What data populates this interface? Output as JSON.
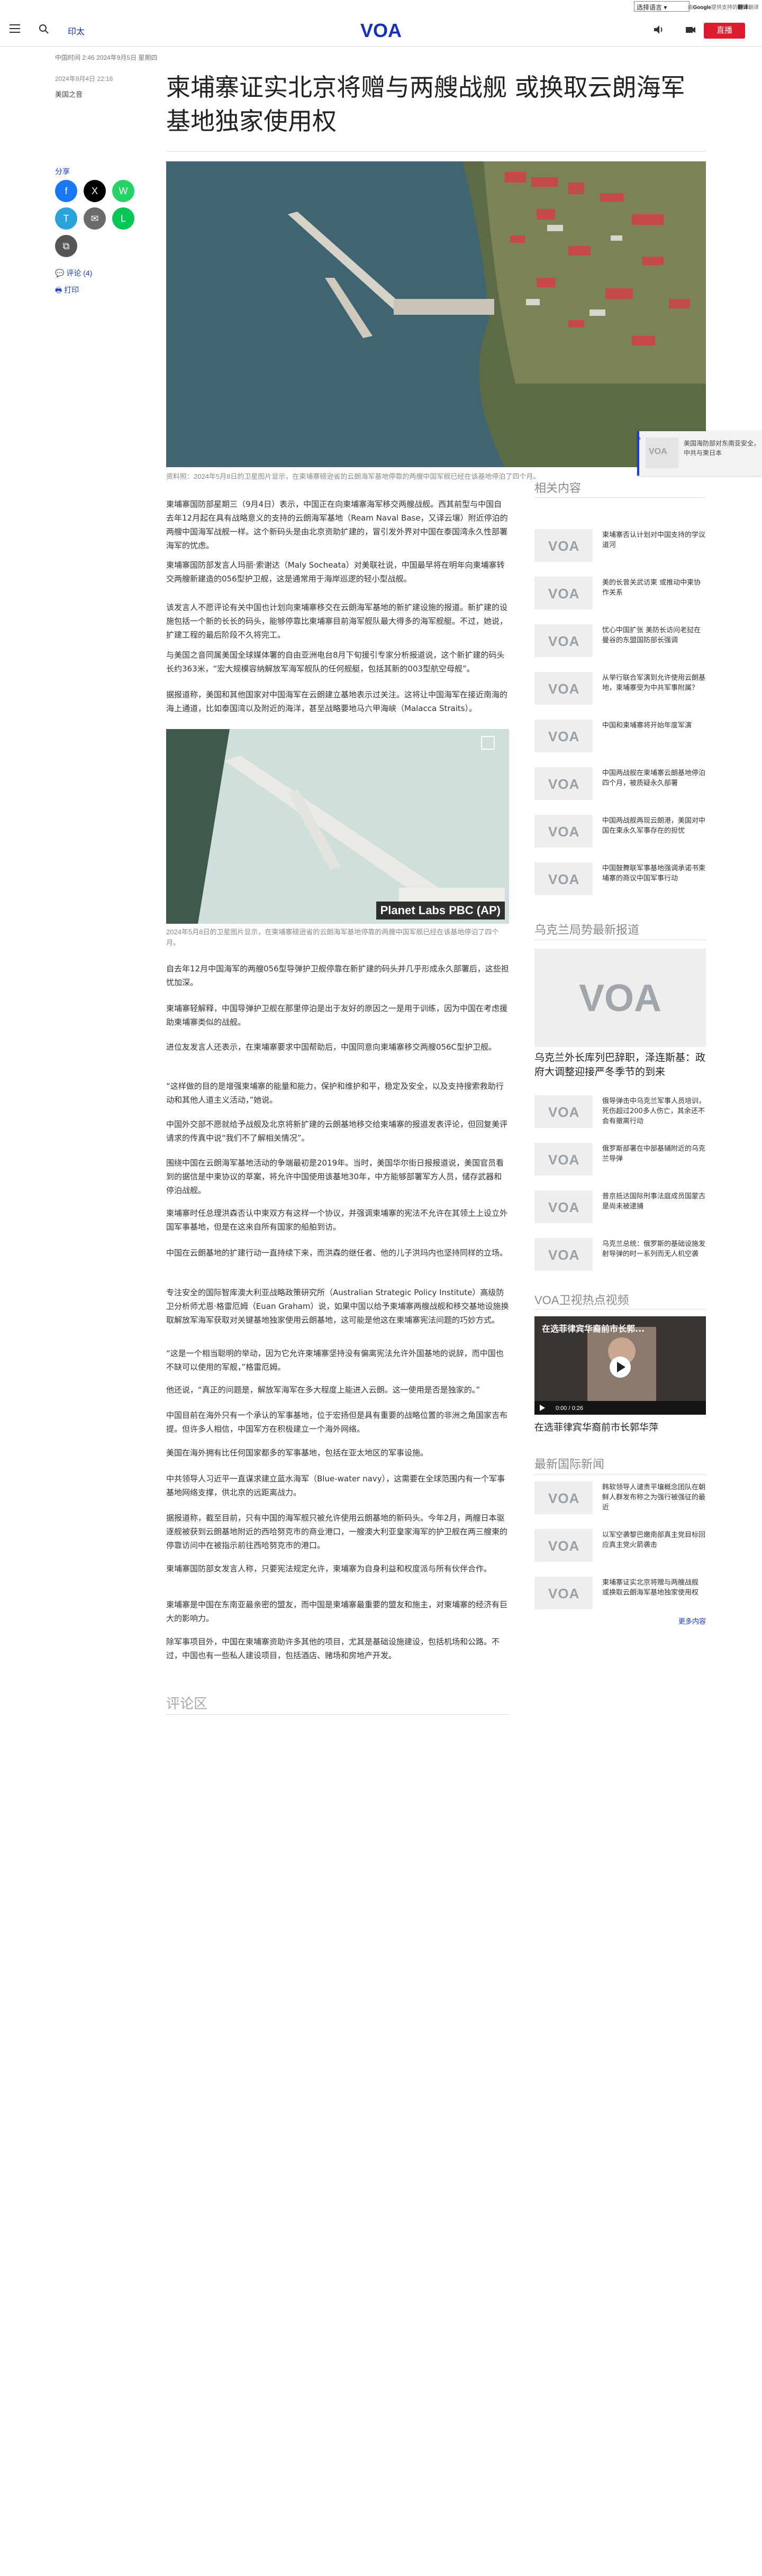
{
  "lang": {
    "select_label": "选择语言",
    "powered_prefix": "由",
    "powered_brand": "Google",
    "powered_mid": "提供支持的",
    "powered_service": "翻译",
    "powered_suffix": "翻译"
  },
  "header": {
    "edition": "印太",
    "logo": "VOA",
    "live": "直播"
  },
  "article": {
    "update_line": "中国时间 2:46 2024年9月5日 星期四",
    "published": "2024年9月4日 22:16",
    "author": "美国之音",
    "title": "柬埔寨证实北京将赠与两艘战舰 或换取云朗海军基地独家使用权",
    "caption": "资料照：2024年5月8日的卫星图片显示，在柬埔寨磅逊省的云朗海军基地停靠的两艘中国军舰已经在该基地停泊了四个月。",
    "inline_caption": "2024年5月8日的卫星图片显示，在柬埔寨磅逊省的云朗海军基地停靠的两艘中国军舰已经在该基地停泊了四个月。",
    "inline_credit": "Planet Labs PBC (AP)",
    "comments_heading": "评论区",
    "paragraphs": [
      "柬埔寨国防部星期三（9月4日）表示，中国正在向柬埔寨海军移交两艘战舰。西其前型与中国自去年12月起在具有战略意义的支持的云朗海军基地（Ream Naval Base，又译云壤）附近停泊的两艘中国海军战舰一样。这个新码头是由北京资助扩建的，冒引发外界对中国在泰国湾永久性部署海军的忧虑。",
      "柬埔寨国防部发言人玛丽·索谢达（Maly Socheata）对美联社说，中国最早将在明年向柬埔寨转交两艘新建造的056型护卫舰，这是通常用于海岸巡逻的轻小型战舰。",
      "该发言人不愿评论有关中国也计划向柬埔寨移交在云朗海军基地的新扩建设施的报道。新扩建的设施包括一个新的长长的码头，能够停靠比柬埔寨目前海军舰队最大得多的海军舰艇。不过，她说，扩建工程的最后阶段不久将完工。",
      "与美国之音同属美国全球媒体署的自由亚洲电台8月下旬援引专家分析报道说，这个新扩建的码头长约363米，“宏大规模容纳解放军海军舰队的任何舰艇，包括其新的003型航空母舰”。",
      "据报道称，美国和其他国家对中国海军在云朗建立基地表示过关注。这将让中国海军在接近南海的海上通道，比如泰国湾以及附近的海洋，甚至战略要地马六甲海峡（Malacca Straits）。",
      "自去年12月中国海军的两艘056型导弹护卫舰停靠在新扩建的码头并几乎形成永久部署后，这些担忧加深。",
      "柬埔寨轻解释，中国导弹护卫舰在那里停泊是出于友好的原因之一是用于训练，因为中国在考虑援助柬埔寨类似的战舰。",
      "进位友发言人还表示，在柬埔寨要求中国帮助后，中国同意向柬埔寨移交两艘056C型护卫舰。",
      "“这样做的目的是增强柬埔寨的能量和能力，保护和维护和平，稳定及安全，以及支持搜索救助行动和其他人道主义活动，”她说。",
      "中国外交部不愿就给予战舰及北京将新扩建的云朗基地移交给柬埔寨的报道发表评论，但回复美评请求的传真中说“我们不了解相关情况”。",
      "围绕中国在云朗海军基地活动的争端最初是2019年。当时，美国华尔街日报报道说，美国官员看到的据信是中柬协议的草案，将允许中国使用该基地30年，中方能够部署军方人员，储存武器和停泊战舰。",
      "柬埔寨时任总理洪森否认中柬双方有这样一个协议，并强调柬埔寨的宪法不允许在其领土上设立外国军事基地，但是在这来自所有国家的船舶到访。",
      "中国在云朗基地的扩建行动一直持续下来，而洪森的继任者、他的儿子洪玛内也坚持同样的立场。",
      "专注安全的国际智库澳大利亚战略政策研究所（Australian Strategic Policy Institute）高级防卫分析师尤恩·格雷厄姆（Euan Graham）说，如果中国以给予柬埔寨两艘战舰和移交基地设施换取解放军海军获取对关键基地独家使用云朗基地，这可能是他这在柬埔寨宪法问题的巧妙方式。",
      "“这是一个相当聪明的举动，因为它允许柬埔寨坚持没有偏离宪法允许外国基地的说辞，而中国也不缺可以使用的军舰，”格雷厄姆。",
      "他还说，“真正的问题是，解放军海军在多大程度上能进入云朗。这一使用是否是独家的。”",
      "中国目前在海外只有一个承认的军事基地，位于宏扬但是具有重要的战略位置的非洲之角国家吉布提。但许多人相信，中国军方在积极建立一个海外网络。",
      "美国在海外拥有比任何国家都多的军事基地，包括在亚太地区的军事设施。",
      "中共领导人习近平一直谋求建立蓝水海军（Blue-water navy），这需要在全球范围内有一个军事基地网络支撑，供北京的远距离战力。",
      "据报道称，截至目前，只有中国的海军舰只被允许使用云朗基地的新码头。今年2月，两艘日本驱逐舰被获到云朗基地附近的西哈努克市的商业港口，一艘澳大利亚皇家海军的护卫舰在两三艘柬的停靠访问中在被指示前往西哈努克市的港口。",
      "柬埔寨国防部女发言人称，只要宪法规定允许，柬埔寨为自身利益和权度派与所有伙伴合作。",
      "柬埔寨是中国在东南亚最亲密的盟友，而中国是柬埔寨最重要的盟友和施主，对柬埔寨的经济有巨大的影响力。",
      "除军事项目外，中国在柬埔寨资助许多其他的项目，尤其是基础设施建设，包括机场和公路。不过，中国也有一些私人建设项目，包括酒店、赌场和房地产开发。"
    ]
  },
  "share": {
    "label": "分享",
    "buttons": [
      "f",
      "X",
      "W",
      "T",
      "✉",
      "L",
      "⧉"
    ],
    "comment": "评论 (4)",
    "print": "打印"
  },
  "sidebar": {
    "related_heading": "相关内容",
    "related": [
      "柬埔寨否认计划对中国支持的学议道河",
      "美的长曾关武访柬 或推动中柬协作关系",
      "忧心中国扩张 美防长访问老挝在曼谷的东盟国防部长强调",
      "从举行联合军演到允许使用云朗基地，柬埔寨受为中共军事附属？",
      "中国和柬埔寨将开始年度军演",
      "中国两战舰在柬埔寨云朗基地停泊四个月，被质疑永久部署",
      "中国两战舰再现云朗港，美国对中国在柬永久军事存在的担忧",
      "中国鼓舞联军事基地强调承诺书柬埔寨的商议中国军事行动"
    ],
    "ukraine_heading": "乌克兰局势最新报道",
    "ukraine_big_title": "乌克兰外长库列巴辞职，泽连斯基：政府大调整迎接严冬季节的到来",
    "ukraine": [
      "俄导弹击中乌克兰军事人员培训，死伤超过200多人伤亡，其余还不会有撤离行动",
      "俄罗斯部署在中部基辅附近的乌克兰导弹",
      "普京抵达国际刑事法庭成员国蒙古是尚未被逮捕",
      "乌克兰总统：俄罗斯的基础设施发射导弹的时一系列而无人机空袭"
    ],
    "video_heading": "VOA卫视热点视频",
    "video_title": "在选菲律宾华裔前市长郭华萍",
    "video_overlay": "在选菲律宾华裔前市长郭...",
    "video_time": "0:00 / 0:26",
    "world_heading": "最新国际新闻",
    "world": [
      "韩软领导人谴责平壤概念团队在朝鲜人群发布称之为强行被强征的最近",
      "以军空袭黎巴嫩南部真主党目标回应真主党火箭袭击",
      "柬埔寨证实北京将赠与两艘战舰 或换取云朗海军基地独家使用权"
    ],
    "more": "更多内容"
  },
  "float_card": {
    "text": "美国海防部对东南亚安全，中共与柬日本"
  },
  "colors": {
    "brand_blue": "#1330bf",
    "live_red": "#dd1a2e",
    "facebook": "#1877f2",
    "twitter": "#000000",
    "whatsapp": "#25d366",
    "telegram": "#2aa3dd",
    "email": "#6b6b6b",
    "line": "#06c755",
    "copy": "#555555"
  },
  "icons": {
    "search": "search-icon",
    "audio": "audio-icon",
    "video": "video-icon",
    "menu": "hamburger-icon"
  }
}
